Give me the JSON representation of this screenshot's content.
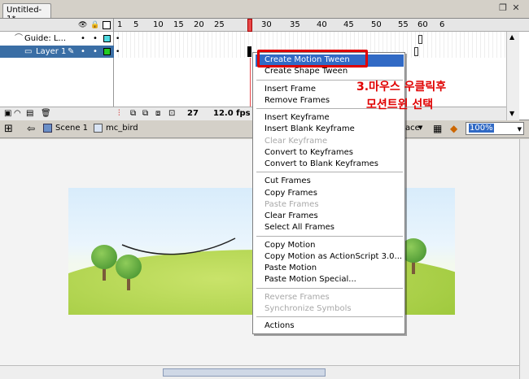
{
  "document": {
    "tab_title": "Untitled-1*"
  },
  "timeline": {
    "frame_numbers": [
      "1",
      "5",
      "10",
      "15",
      "20",
      "25",
      "30",
      "35",
      "40",
      "45",
      "50",
      "55",
      "60",
      "6"
    ],
    "layers": [
      {
        "name": "Guide: L..."
      },
      {
        "name": "Layer 1"
      }
    ],
    "status": {
      "current_frame": "27",
      "fps": "12.0 fps"
    }
  },
  "editbar": {
    "scene": "Scene 1",
    "symbol": "mc_bird",
    "workspace_fragment": "ace",
    "zoom": "100%"
  },
  "context_menu": {
    "groups": [
      [
        {
          "label": "Create Motion Tween",
          "highlighted": true
        },
        {
          "label": "Create Shape Tween"
        }
      ],
      [
        {
          "label": "Insert Frame"
        },
        {
          "label": "Remove Frames"
        }
      ],
      [
        {
          "label": "Insert Keyframe"
        },
        {
          "label": "Insert Blank Keyframe"
        },
        {
          "label": "Clear Keyframe",
          "disabled": true
        },
        {
          "label": "Convert to Keyframes"
        },
        {
          "label": "Convert to Blank Keyframes"
        }
      ],
      [
        {
          "label": "Cut Frames"
        },
        {
          "label": "Copy Frames"
        },
        {
          "label": "Paste Frames",
          "disabled": true
        },
        {
          "label": "Clear Frames"
        },
        {
          "label": "Select All Frames"
        }
      ],
      [
        {
          "label": "Copy Motion"
        },
        {
          "label": "Copy Motion as ActionScript 3.0..."
        },
        {
          "label": "Paste Motion"
        },
        {
          "label": "Paste Motion Special..."
        }
      ],
      [
        {
          "label": "Reverse Frames",
          "disabled": true
        },
        {
          "label": "Synchronize Symbols",
          "disabled": true
        }
      ],
      [
        {
          "label": "Actions"
        }
      ]
    ]
  },
  "annotation": {
    "line1": "3.마우스 우클릭후",
    "line2": "모션트윈 선택",
    "color": "#e00000"
  },
  "colors": {
    "highlight": "#316ac5",
    "playhead": "#e8484a"
  }
}
